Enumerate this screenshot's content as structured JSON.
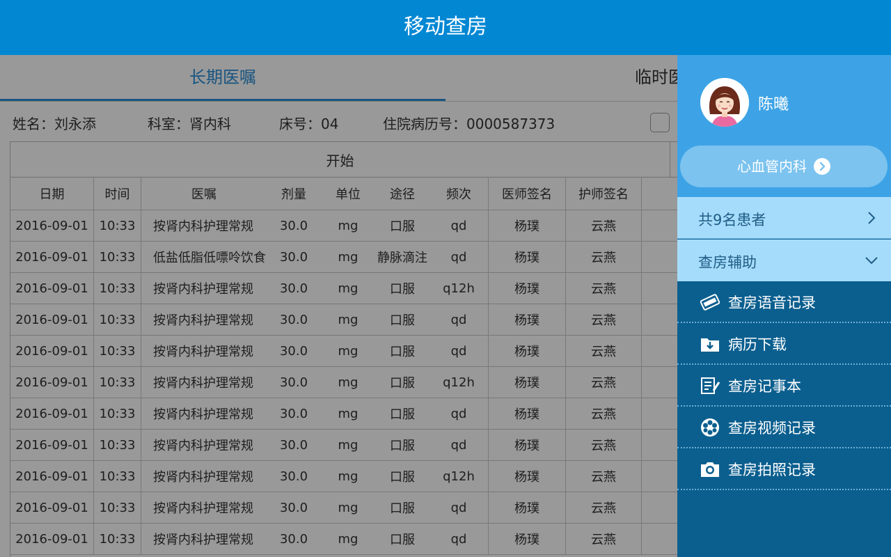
{
  "header": {
    "title": "移动查房"
  },
  "tabs": [
    {
      "label": "长期医嘱"
    },
    {
      "label": "临时医嘱"
    }
  ],
  "patient": {
    "name": "姓名：刘永添",
    "dept": "科室：肾内科",
    "bed": "床号：04",
    "record": "住院病历号：0000587373"
  },
  "table": {
    "group_label": "开始",
    "headers": [
      "日期",
      "时间",
      "医嘱",
      "剂量",
      "单位",
      "途径",
      "频次",
      "医师签名",
      "护师签名"
    ],
    "rows": [
      [
        "2016-09-01",
        "10:33",
        "按肾内科护理常规",
        "30.0",
        "mg",
        "口服",
        "qd",
        "杨璞",
        "云燕"
      ],
      [
        "2016-09-01",
        "10:33",
        "低盐低脂低嘌呤饮食",
        "30.0",
        "mg",
        "静脉滴注",
        "qd",
        "杨璞",
        "云燕"
      ],
      [
        "2016-09-01",
        "10:33",
        "按肾内科护理常规",
        "30.0",
        "mg",
        "口服",
        "q12h",
        "杨璞",
        "云燕"
      ],
      [
        "2016-09-01",
        "10:33",
        "按肾内科护理常规",
        "30.0",
        "mg",
        "口服",
        "qd",
        "杨璞",
        "云燕"
      ],
      [
        "2016-09-01",
        "10:33",
        "按肾内科护理常规",
        "30.0",
        "mg",
        "口服",
        "qd",
        "杨璞",
        "云燕"
      ],
      [
        "2016-09-01",
        "10:33",
        "按肾内科护理常规",
        "30.0",
        "mg",
        "口服",
        "q12h",
        "杨璞",
        "云燕"
      ],
      [
        "2016-09-01",
        "10:33",
        "按肾内科护理常规",
        "30.0",
        "mg",
        "口服",
        "qd",
        "杨璞",
        "云燕"
      ],
      [
        "2016-09-01",
        "10:33",
        "按肾内科护理常规",
        "30.0",
        "mg",
        "口服",
        "qd",
        "杨璞",
        "云燕"
      ],
      [
        "2016-09-01",
        "10:33",
        "按肾内科护理常规",
        "30.0",
        "mg",
        "口服",
        "q12h",
        "杨璞",
        "云燕"
      ],
      [
        "2016-09-01",
        "10:33",
        "按肾内科护理常规",
        "30.0",
        "mg",
        "口服",
        "qd",
        "杨璞",
        "云燕"
      ],
      [
        "2016-09-01",
        "10:33",
        "按肾内科护理常规",
        "30.0",
        "mg",
        "口服",
        "qd",
        "杨璞",
        "云燕"
      ]
    ]
  },
  "drawer": {
    "user_name": "陈曦",
    "department": "心血管内科",
    "patients_label": "共9名患者",
    "assist_label": "查房辅助",
    "menu": [
      {
        "label": "查房语音记录",
        "icon": "voice-card-icon"
      },
      {
        "label": "病历下载",
        "icon": "download-folder-icon"
      },
      {
        "label": "查房记事本",
        "icon": "notebook-icon"
      },
      {
        "label": "查房视频记录",
        "icon": "film-reel-icon"
      },
      {
        "label": "查房拍照记录",
        "icon": "camera-icon"
      }
    ]
  },
  "colors": {
    "header": "#0287d3",
    "drawer_top": "#3da3e6",
    "drawer_menu": "#0b5f8f",
    "drawer_row": "#a6dcfb",
    "tab_active": "#2a8ed6"
  }
}
